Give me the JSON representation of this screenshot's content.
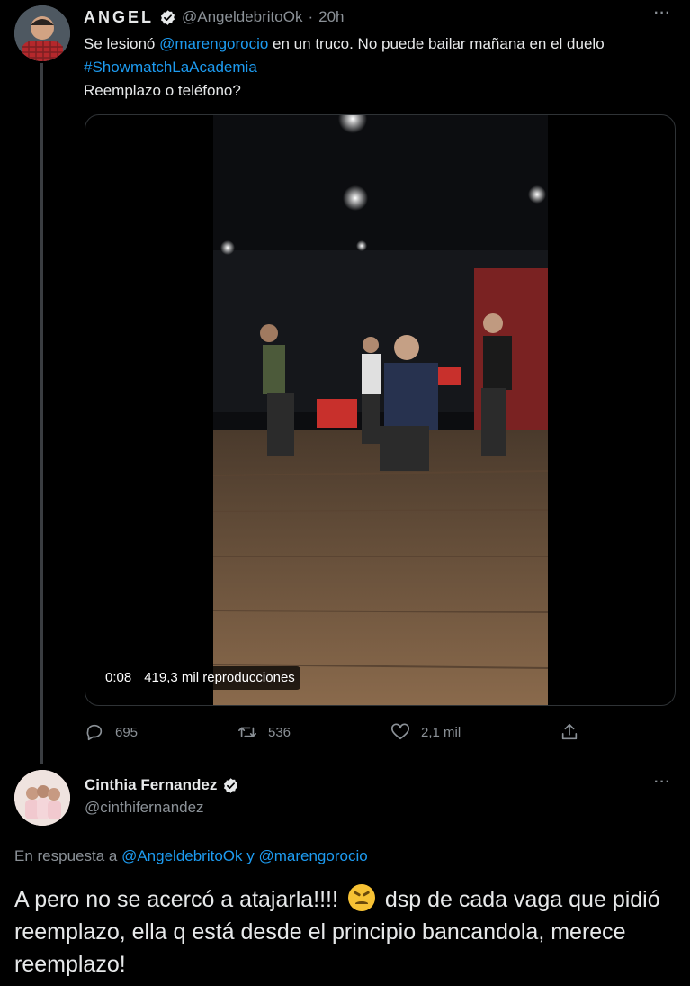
{
  "tweet1": {
    "name": "ANGEL",
    "handle": "@AngeldebritoOk",
    "separator": "·",
    "time": "20h",
    "more": "···",
    "text_part1": "Se lesionó ",
    "mention": "@marengorocio",
    "text_part2": " en un truco. No puede bailar mañana en el duelo",
    "hashtag": "#ShowmatchLaAcademia",
    "text_line3": "Reemplazo o teléfono?",
    "video": {
      "duration": "0:08",
      "views": "419,3 mil reproducciones"
    },
    "actions": {
      "replies": "695",
      "retweets": "536",
      "likes": "2,1 mil"
    },
    "icons": [
      "reply-icon",
      "retweet-icon",
      "like-icon",
      "share-icon",
      "verified-icon"
    ]
  },
  "tweet2": {
    "name": "Cinthia Fernandez",
    "handle": "@cinthifernandez",
    "more": "···",
    "reply_prefix": "En respuesta a ",
    "reply_user1": "@AngeldebritoOk",
    "reply_and": " y ",
    "reply_user2": "@marengorocio",
    "text_before_emoji": "A pero no se acercó a atajarla!!!! ",
    "text_after_emoji": " dsp de cada vaga que pidió reemplazo, ella q está desde el principio bancandola, merece reemplazo!",
    "emoji": "confounded-face"
  },
  "colors": {
    "background": "#000000",
    "text": "#e7e9ea",
    "secondary": "#8b9197",
    "link": "#1d9bf0",
    "border": "#2f3336"
  }
}
